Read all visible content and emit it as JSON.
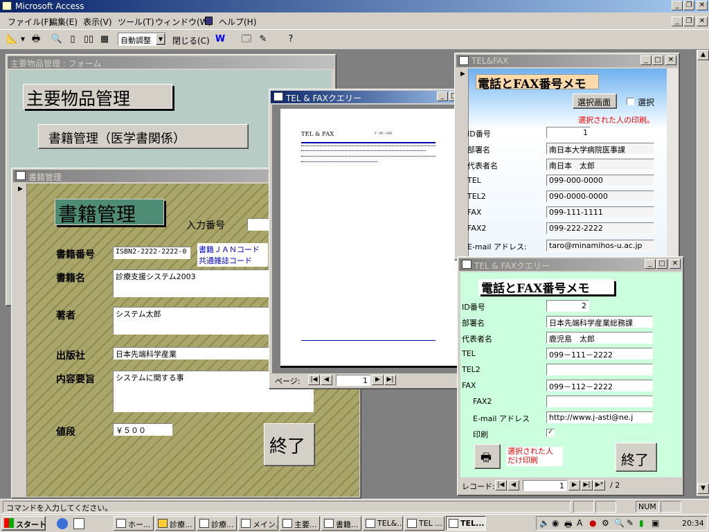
{
  "app": {
    "title": "Microsoft Access"
  },
  "menu": [
    "ファイル(F)",
    "編集(E)",
    "表示(V)",
    "ツール(T)",
    "ウィンドウ(W)",
    "ヘルプ(H)"
  ],
  "toolbar": {
    "zoom_value": "自動調整",
    "close_label": "閉じる(C)"
  },
  "main_form": {
    "title": "主要物品管理 : フォーム",
    "heading": "主要物品管理",
    "button": "書籍管理（医学書関係）"
  },
  "book_form": {
    "title": "書籍管理",
    "heading": "書籍管理",
    "input_label": "入力番号",
    "isbn_label": "書籍番号",
    "isbn_value": "ISBN2-2222-2222-0",
    "jan_line1": "書籍ＪＡＮコード",
    "jan_line2": "共通雑誌コード",
    "name_label": "書籍名",
    "name_value": "診療支援システム2003",
    "author_label": "著者",
    "author_value": "システム太郎",
    "publisher_label": "出版社",
    "publisher_value": "日本先端科学産業",
    "summary_label": "内容要旨",
    "summary_value": "システムに関する事",
    "price_label": "値段",
    "price_value": "￥５００",
    "exit_button": "終了"
  },
  "query_window": {
    "title": "TEL & FAXクエリー",
    "page_label": "ページ:",
    "page_value": "1",
    "preview": {
      "title": "TEL & FAX",
      "right": "ﾃﾞｰﾀﾍﾞｰｽﾒﾓ"
    }
  },
  "telfax_form": {
    "title": "TEL&FAX",
    "heading": "電話とFAX番号メモ",
    "select_button": "選択画面",
    "select_check": "選択",
    "red_note": "選択された人の印刷。",
    "rows": [
      {
        "label": "ID番号",
        "value": "1"
      },
      {
        "label": "部署名",
        "value": "南日本大学病院医事課"
      },
      {
        "label": "代表者名",
        "value": "南日本　太郎"
      },
      {
        "label": "TEL",
        "value": "099-000-0000"
      },
      {
        "label": "TEL2",
        "value": "090-0000-0000"
      },
      {
        "label": "FAX",
        "value": "099-111-1111"
      },
      {
        "label": "FAX2",
        "value": "099-222-2222"
      },
      {
        "label": "E-mail アドレス:",
        "value": "taro@minamihos-u.ac.jp"
      }
    ]
  },
  "telfax_query": {
    "title": "TEL & FAXクエリー",
    "heading": "電話とFAX番号メモ",
    "rows": [
      {
        "label": "ID番号",
        "value": "2"
      },
      {
        "label": "部署名",
        "value": "日本先端科学産業総務課"
      },
      {
        "label": "代表者名",
        "value": "鹿児島　太郎"
      },
      {
        "label": "TEL",
        "value": "099－111－2222"
      },
      {
        "label": "TEL2",
        "value": ""
      },
      {
        "label": "FAX",
        "value": "099－112－2222"
      },
      {
        "label": "FAX2",
        "value": ""
      },
      {
        "label": "E-mail アドレス",
        "value": "http://www.j-asti@ne.j"
      }
    ],
    "print_label": "印刷",
    "note_line1": "選択された人",
    "note_line2": "だけ印刷",
    "exit_button": "終了",
    "record_label": "レコード:",
    "record_value": "1",
    "record_total": "/ 2"
  },
  "status": {
    "message": "コマンドを入力してください。",
    "num": "NUM"
  },
  "taskbar": {
    "start": "スタート",
    "tasks": [
      "ホー...",
      "診療...",
      "診療...",
      "メイン...",
      "主要...",
      "書籍...",
      "TEL&...",
      "TEL ...",
      "TEL..."
    ],
    "clock": "20:34"
  },
  "colors": {
    "title_active": "#0a246a",
    "face": "#d4d0c8",
    "main_form_bg": "#b6ccc4",
    "query_bg": "#ccffdd",
    "red": "#ff0000"
  }
}
